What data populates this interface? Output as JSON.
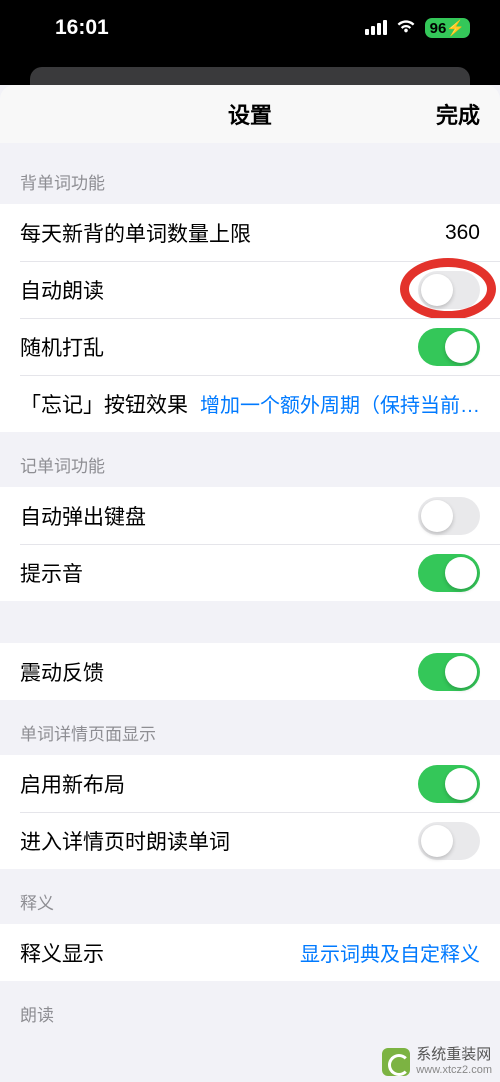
{
  "status": {
    "time": "16:01",
    "battery": "96"
  },
  "nav": {
    "title": "设置",
    "done": "完成"
  },
  "sections": {
    "vocab_learn": {
      "header": "背单词功能",
      "daily_limit_label": "每天新背的单词数量上限",
      "daily_limit_value": "360",
      "auto_read_label": "自动朗读",
      "auto_read_on": false,
      "shuffle_label": "随机打乱",
      "shuffle_on": true,
      "forget_label": "「忘记」按钮效果",
      "forget_value": "增加一个额外周期（保持当前…"
    },
    "vocab_record": {
      "header": "记单词功能",
      "auto_kb_label": "自动弹出键盘",
      "auto_kb_on": false,
      "sound_label": "提示音",
      "sound_on": true,
      "haptic_label": "震动反馈",
      "haptic_on": true
    },
    "detail_page": {
      "header": "单词详情页面显示",
      "new_layout_label": "启用新布局",
      "new_layout_on": true,
      "read_on_enter_label": "进入详情页时朗读单词",
      "read_on_enter_on": false
    },
    "definition": {
      "header": "释义",
      "show_label": "释义显示",
      "show_value": "显示词典及自定释义"
    },
    "reading": {
      "header": "朗读"
    }
  },
  "watermark": {
    "title": "系统重装网",
    "url": "www.xtcz2.com"
  }
}
